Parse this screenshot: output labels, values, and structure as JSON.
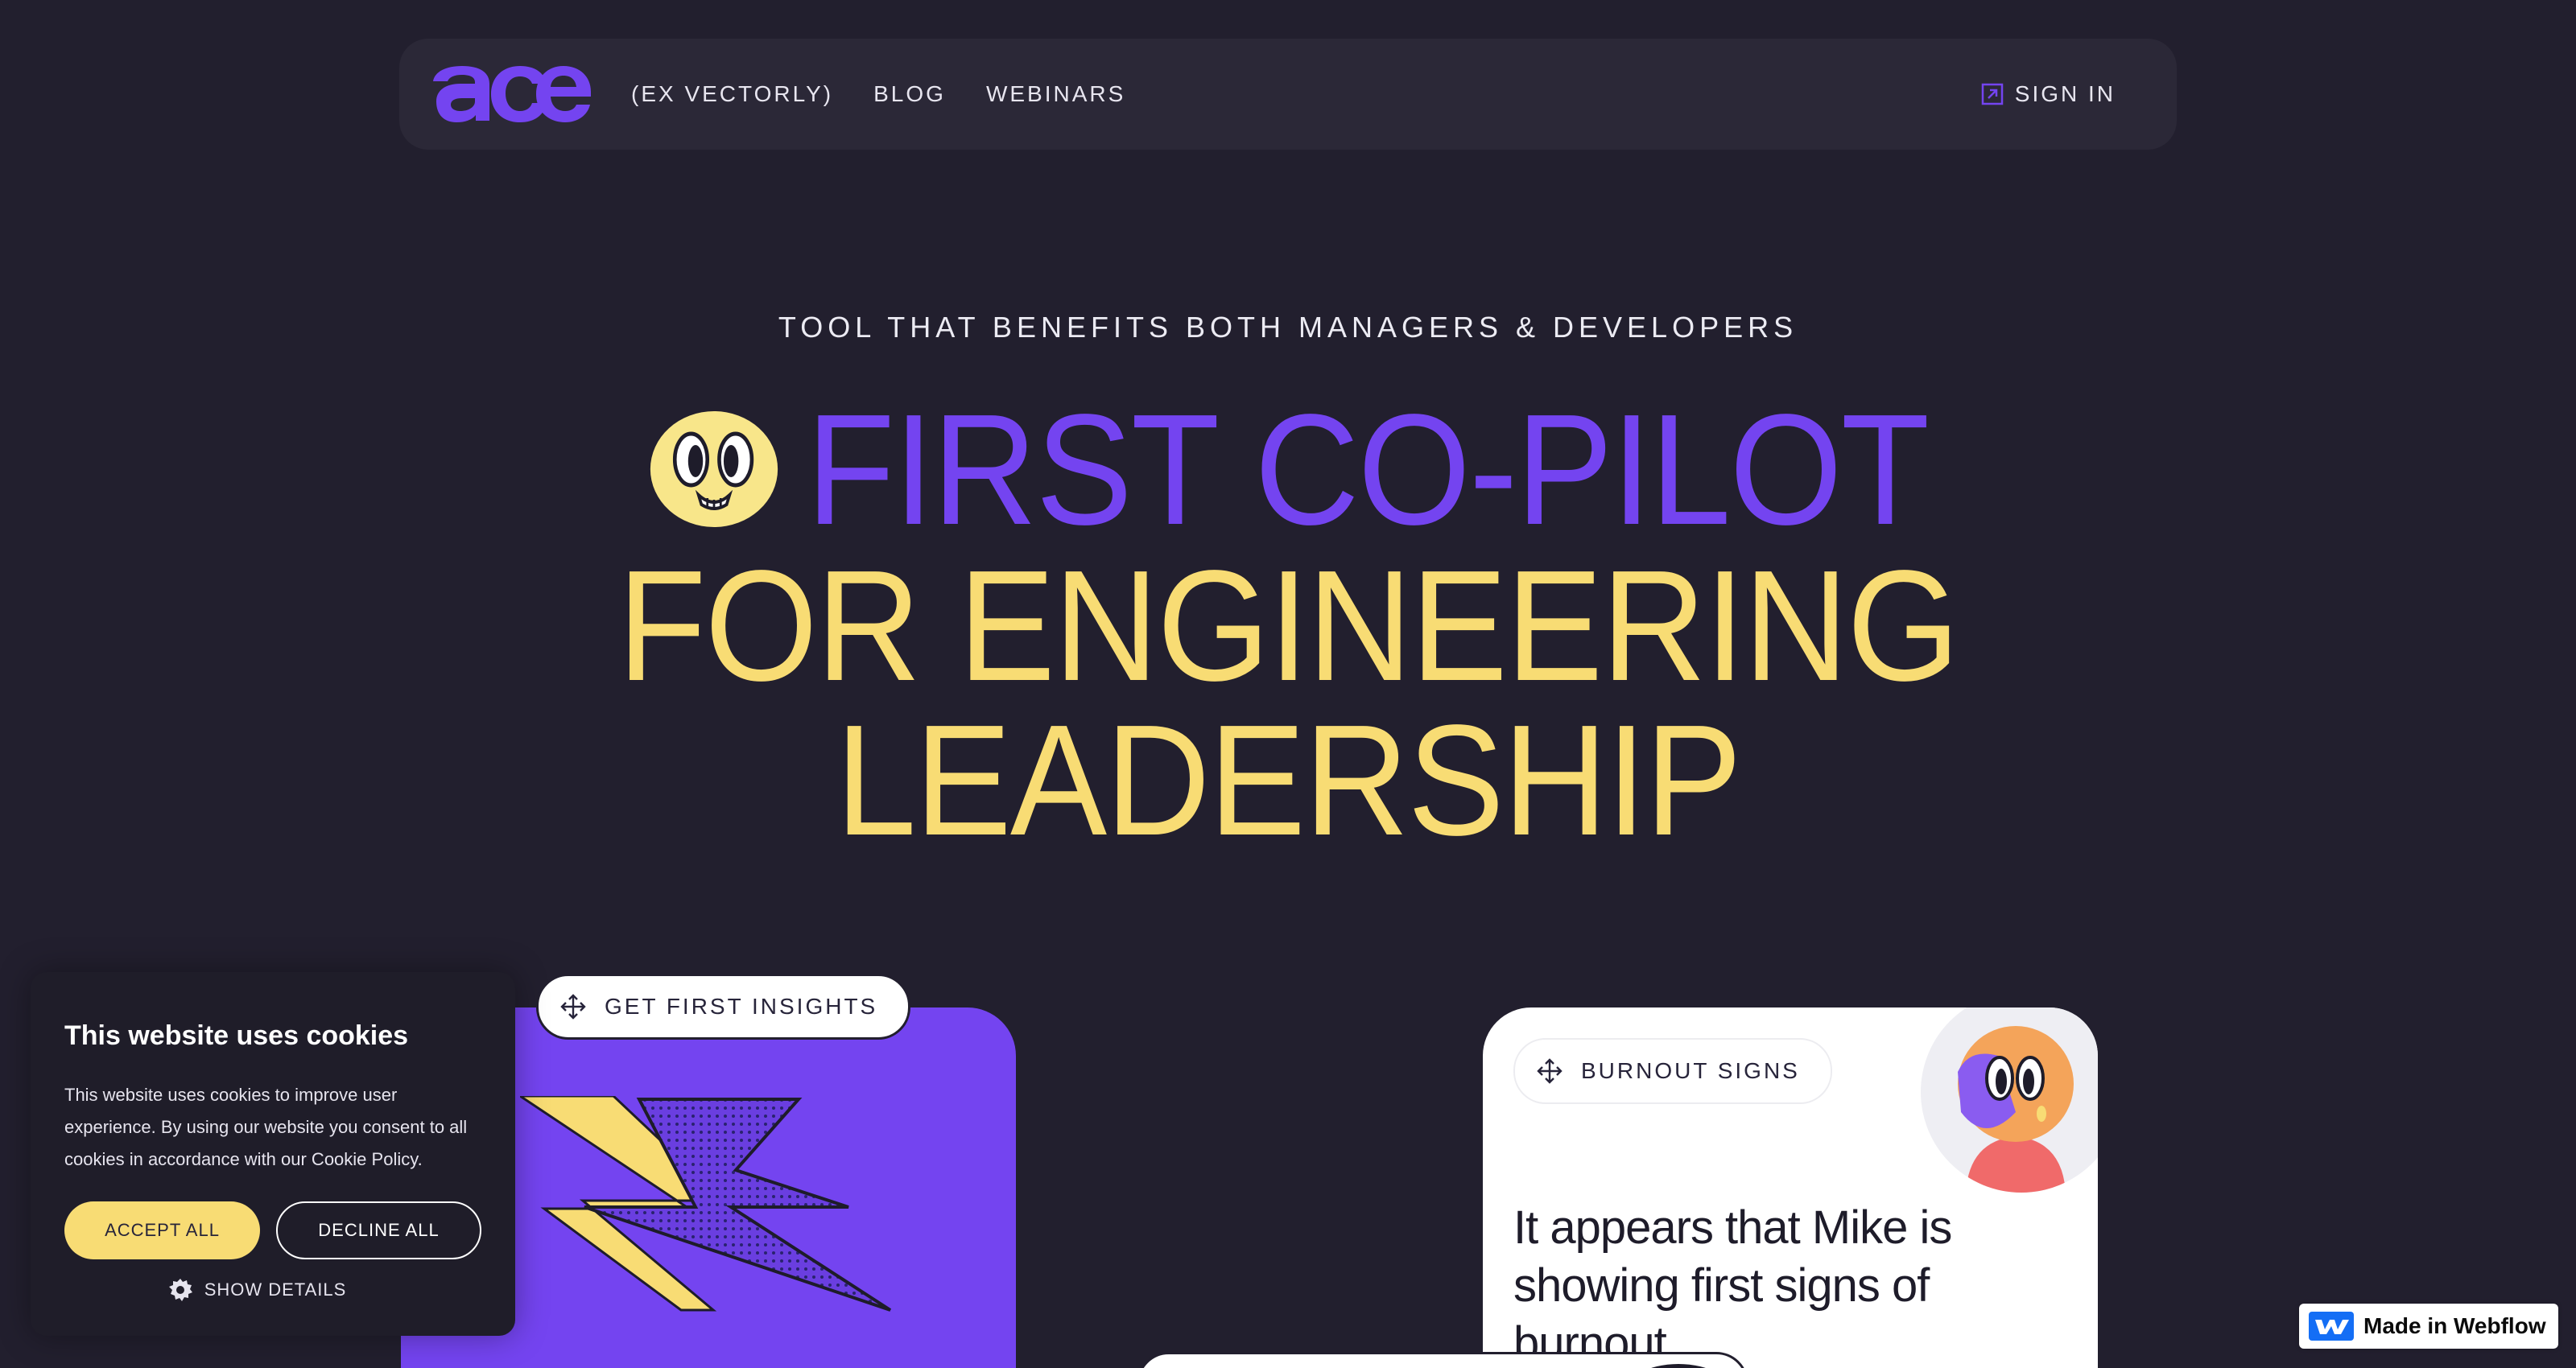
{
  "nav": {
    "logo_text": "ace",
    "links": [
      "(EX VECTORLY)",
      "BLOG",
      "WEBINARS"
    ],
    "signin_label": "SIGN IN"
  },
  "hero": {
    "eyebrow": "TOOL THAT BENEFITS BOTH MANAGERS & DEVELOPERS",
    "line1": "FIRST CO-PILOT",
    "line2": "FOR ENGINEERING",
    "line3": "LEADERSHIP"
  },
  "cards": {
    "insights_label": "GET FIRST INSIGHTS",
    "burnout_label": "BURNOUT SIGNS",
    "burnout_text": "It appears that Mike is showing first signs of burnout"
  },
  "cookie": {
    "title": "This website uses cookies",
    "body": "This website uses cookies to improve user experience. By using our website you consent to all cookies in accordance with our Cookie Policy.",
    "accept_label": "ACCEPT ALL",
    "decline_label": "DECLINE ALL",
    "details_label": "SHOW DETAILS"
  },
  "badge": {
    "label": "Made in Webflow"
  },
  "colors": {
    "background": "#221f2e",
    "accent_purple": "#7444f0",
    "accent_yellow": "#f8dc74"
  }
}
